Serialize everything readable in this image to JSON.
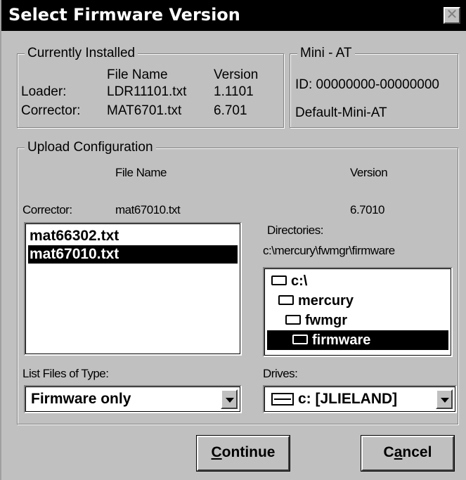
{
  "window": {
    "title": "Select Firmware Version",
    "close_glyph": "✕"
  },
  "currently_installed": {
    "legend": "Currently Installed",
    "col_file": "File Name",
    "col_version": "Version",
    "rows": [
      {
        "label": "Loader:",
        "file": "LDR11101.txt",
        "version": "1.1101"
      },
      {
        "label": "Corrector:",
        "file": "MAT6701.txt",
        "version": "6.701"
      }
    ]
  },
  "device": {
    "legend": "Mini - AT",
    "id": "ID: 00000000-00000000",
    "name": "Default-Mini-AT"
  },
  "upload": {
    "legend": "Upload Configuration",
    "col_file": "File Name",
    "col_version": "Version",
    "row_label": "Corrector:",
    "row_file": "mat67010.txt",
    "row_version": "6.7010",
    "files": [
      {
        "name": "mat66302.txt",
        "selected": false
      },
      {
        "name": "mat67010.txt",
        "selected": true
      }
    ],
    "directories_label": "Directories:",
    "directory_path": "c:\\mercury\\fwmgr\\firmware",
    "directories": [
      {
        "name": "c:\\",
        "selected": false
      },
      {
        "name": "mercury",
        "selected": false
      },
      {
        "name": "fwmgr",
        "selected": false
      },
      {
        "name": "firmware",
        "selected": true
      }
    ],
    "file_type_label": "List Files of Type:",
    "file_type_value": "Firmware only",
    "drives_label": "Drives:",
    "drive_value": "c: [JLIELAND]"
  },
  "buttons": {
    "continue_mnemonic": "C",
    "continue_rest": "ontinue",
    "cancel_pre": "C",
    "cancel_mnemonic": "a",
    "cancel_rest": "ncel"
  },
  "icons": {
    "folder": "folder-icon",
    "open_folder": "open-folder-icon",
    "drive": "drive-icon",
    "dropdown": "chevron-down-icon"
  }
}
